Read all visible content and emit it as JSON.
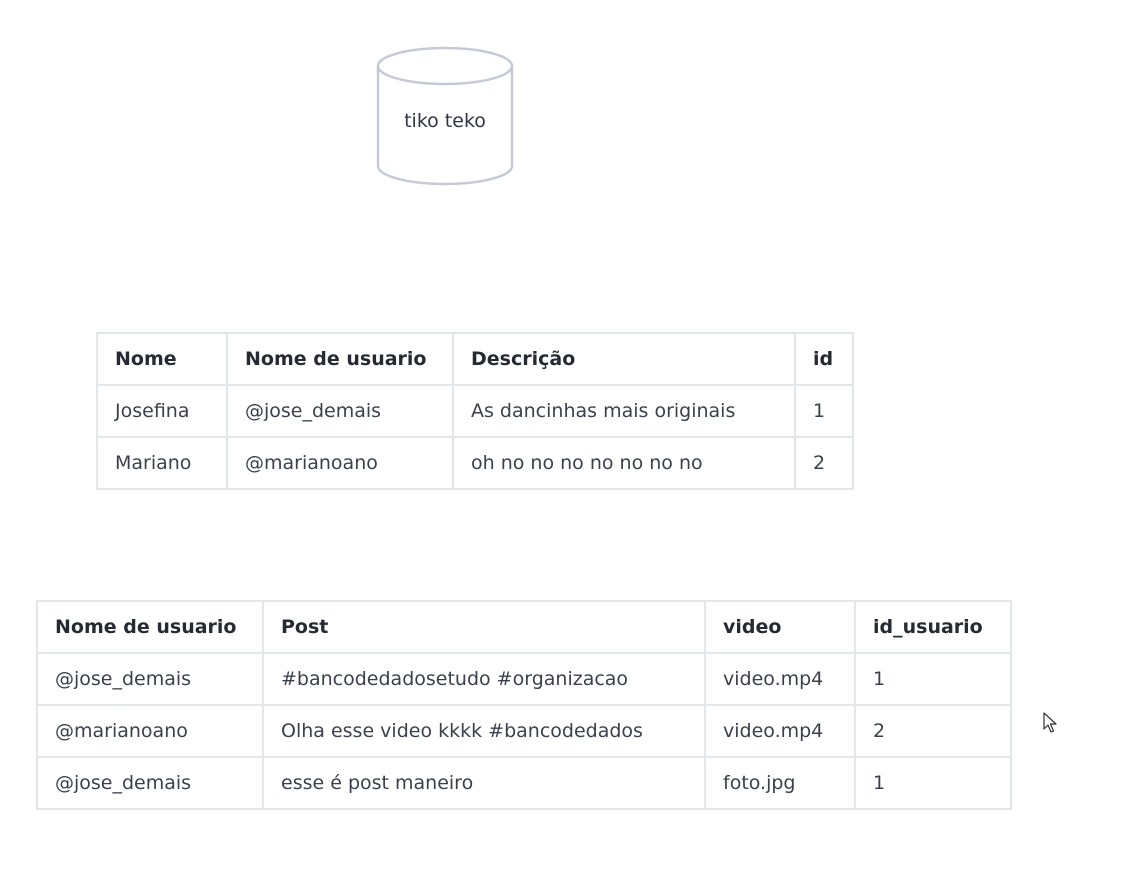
{
  "database": {
    "label": "tiko teko"
  },
  "users_table": {
    "headers": [
      "Nome",
      "Nome de usuario",
      "Descrição",
      "id"
    ],
    "rows": [
      [
        "Josefina",
        "@jose_demais",
        "As dancinhas mais originais",
        "1"
      ],
      [
        "Mariano",
        "@marianoano",
        "oh no no no no no no no",
        "2"
      ]
    ]
  },
  "posts_table": {
    "headers": [
      "Nome de usuario",
      "Post",
      "video",
      "id_usuario"
    ],
    "rows": [
      [
        "@jose_demais",
        "#bancodedadosetudo #organizacao",
        "video.mp4",
        "1"
      ],
      [
        "@marianoano",
        "Olha esse video kkkk #bancodedados",
        "video.mp4",
        "2"
      ],
      [
        "@jose_demais",
        "esse é post maneiro",
        "foto.jpg",
        "1"
      ]
    ]
  },
  "cursor": {
    "icon": "mouse-pointer-icon"
  }
}
